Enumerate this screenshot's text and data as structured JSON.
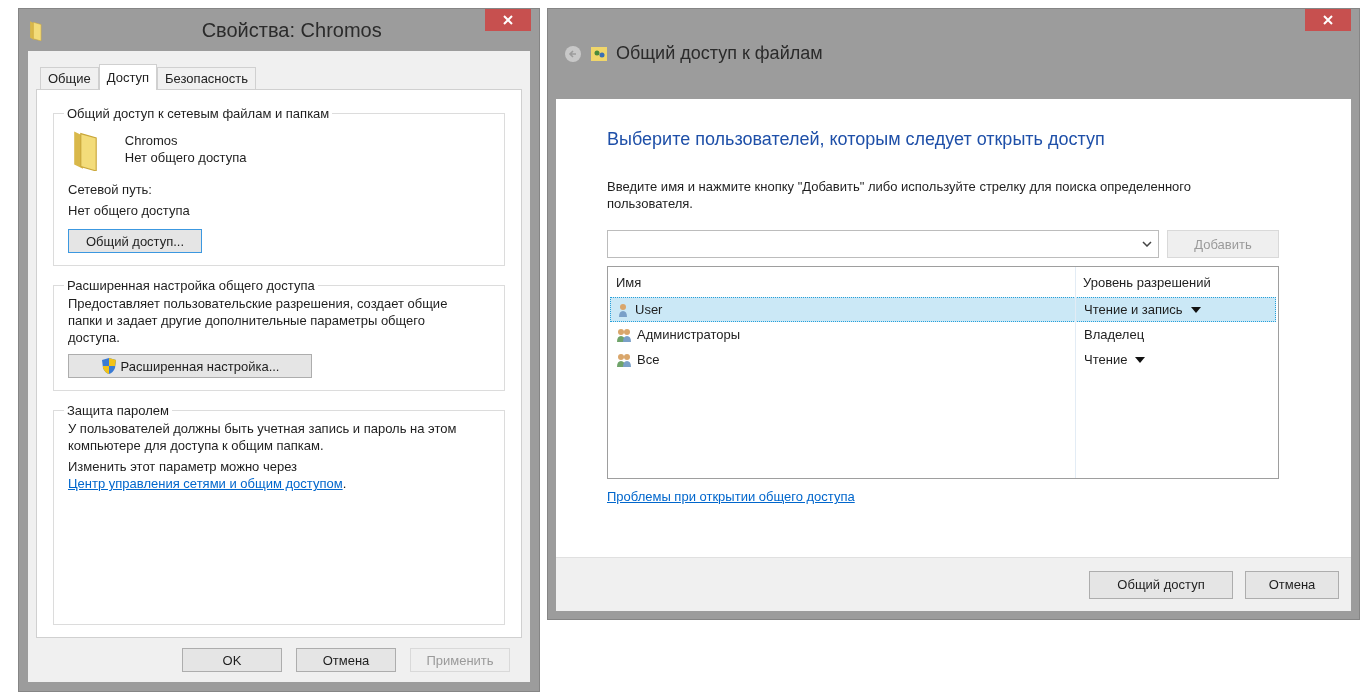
{
  "properties_window": {
    "title": "Свойства: Chromos",
    "tabs": [
      {
        "label": "Общие",
        "selected": false
      },
      {
        "label": "Доступ",
        "selected": true
      },
      {
        "label": "Безопасность",
        "selected": false
      }
    ],
    "network_sharing": {
      "legend": "Общий доступ к сетевым файлам и папкам",
      "folder_name": "Chromos",
      "folder_status": "Нет общего доступа",
      "path_label": "Сетевой путь:",
      "path_value": "Нет общего доступа",
      "button": "Общий доступ..."
    },
    "advanced_sharing": {
      "legend": "Расширенная настройка общего доступа",
      "description": "Предоставляет пользовательские разрешения, создает общие папки и задает другие дополнительные параметры общего доступа.",
      "button": "Расширенная настройка..."
    },
    "password_protection": {
      "legend": "Защита паролем",
      "description": "У пользователей должны быть учетная запись и пароль на этом компьютере для доступа к общим папкам.",
      "change_text": "Изменить этот параметр можно через",
      "link": "Центр управления сетями и общим доступом",
      "after_link": "."
    },
    "buttons": [
      {
        "label": "OK",
        "disabled": false
      },
      {
        "label": "Отмена",
        "disabled": false
      },
      {
        "label": "Применить",
        "disabled": true
      }
    ]
  },
  "file_sharing_window": {
    "title": "Общий доступ к файлам",
    "heading": "Выберите пользователей, которым следует открыть доступ",
    "instructions": "Введите имя и нажмите кнопку \"Добавить\" либо используйте стрелку для поиска определенного пользователя.",
    "add_button": {
      "label": "Добавить",
      "disabled": true
    },
    "table": {
      "columns": [
        "Имя",
        "Уровень разрешений"
      ],
      "rows": [
        {
          "kind": "user",
          "name": "User",
          "permission": "Чтение и запись",
          "dropdown": true,
          "selected": true
        },
        {
          "kind": "group",
          "name": "Администраторы",
          "permission": "Владелец",
          "dropdown": false,
          "selected": false
        },
        {
          "kind": "group",
          "name": "Все",
          "permission": "Чтение",
          "dropdown": true,
          "selected": false
        }
      ]
    },
    "help_link": "Проблемы при открытии общего доступа",
    "buttons": [
      {
        "label": "Общий доступ",
        "disabled": false
      },
      {
        "label": "Отмена",
        "disabled": false
      }
    ]
  }
}
